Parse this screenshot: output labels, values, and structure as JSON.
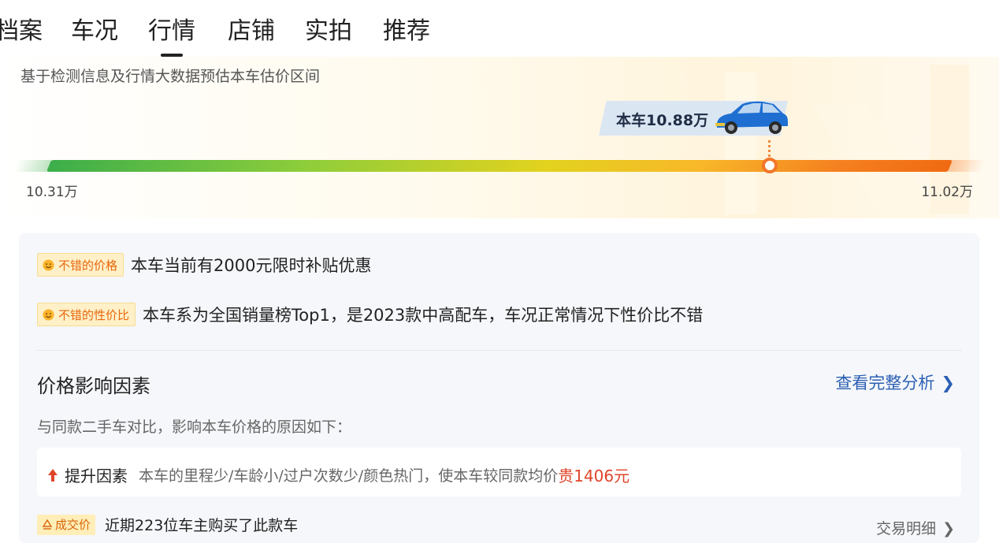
{
  "tabs": [
    {
      "label": "档案"
    },
    {
      "label": "车况"
    },
    {
      "label": "行情",
      "active": true
    },
    {
      "label": "店铺"
    },
    {
      "label": "实拍"
    },
    {
      "label": "推荐"
    }
  ],
  "estimate": {
    "subtitle": "基于检测信息及行情大数据预估本车估价区间",
    "current_label": "本车10.88万",
    "min_label": "10.31万",
    "max_label": "11.02万",
    "min_value": 10.31,
    "max_value": 11.02,
    "current_value": 10.88
  },
  "highlights": [
    {
      "tag": "不错的价格",
      "text": "本车当前有2000元限时补贴优惠",
      "icon": "smile-icon"
    },
    {
      "tag": "不错的性价比",
      "text": "本车系为全国销量榜Top1，是2023款中高配车，车况正常情况下性价比不错",
      "icon": "smile-icon"
    }
  ],
  "factors": {
    "title": "价格影响因素",
    "link": "查看完整分析",
    "compare_text": "与同款二手车对比，影响本车价格的原因如下：",
    "up": {
      "label": "提升因素",
      "desc": "本车的里程少/车龄小/过户次数少/颜色热门",
      "desc2": "，使本车较同款均价",
      "price": "贵1406元"
    }
  },
  "deal": {
    "tag": "成交价",
    "text": "近期223位车主购买了此款车",
    "link": "交易明细"
  },
  "colors": {
    "accent_orange": "#f4762a",
    "link_blue": "#2b5fb3",
    "price_red": "#e0452a",
    "tag_bg": "#fff0c7"
  }
}
